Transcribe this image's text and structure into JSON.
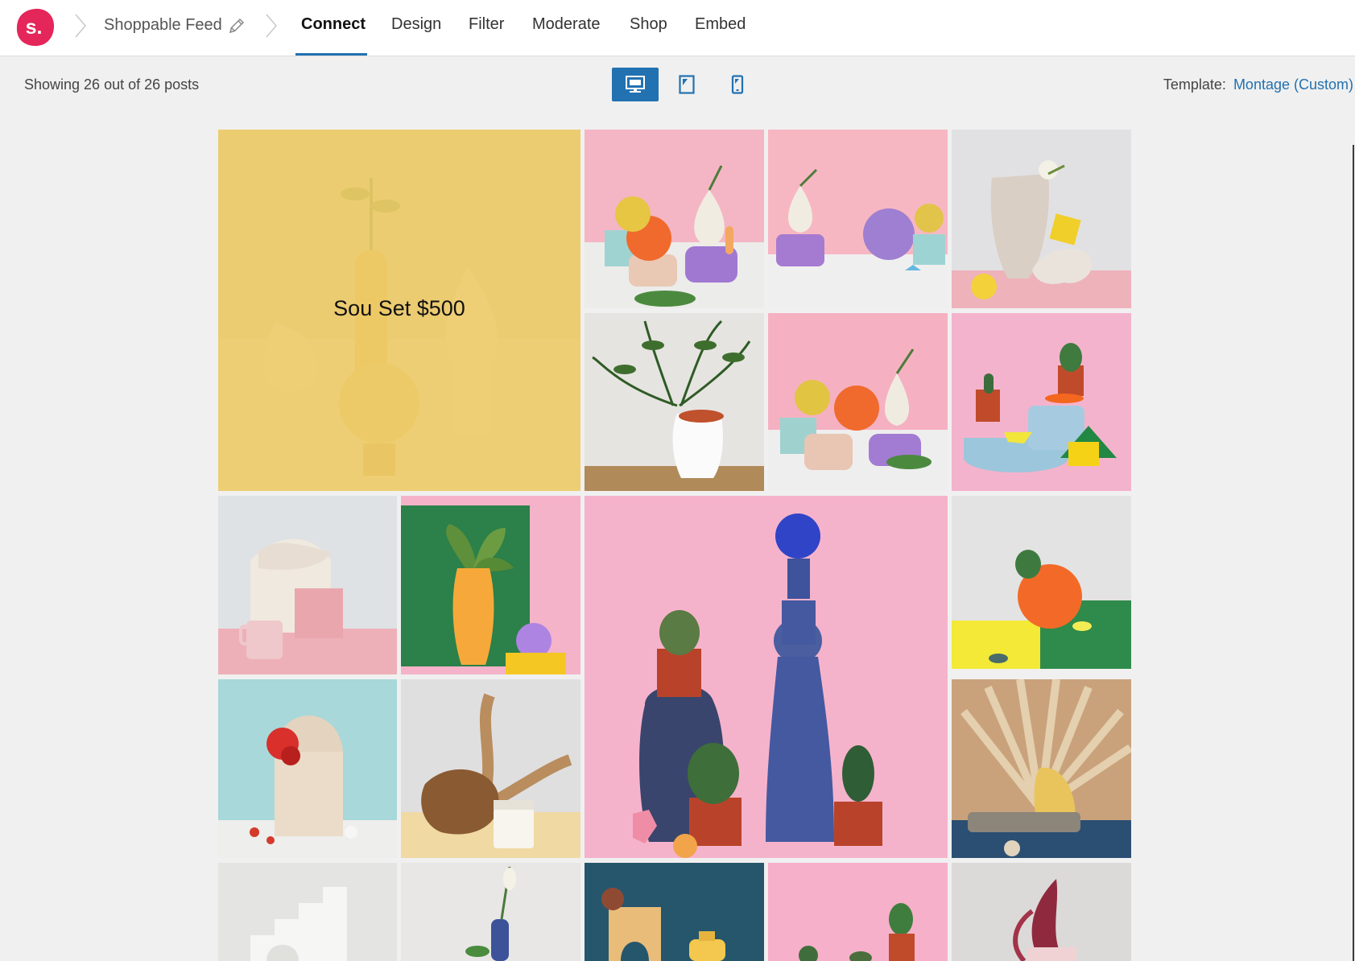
{
  "header": {
    "logo_letter": "s.",
    "feed_name": "Shoppable Feed",
    "tabs": [
      {
        "label": "Connect",
        "active": true
      },
      {
        "label": "Design",
        "active": false
      },
      {
        "label": "Filter",
        "active": false
      },
      {
        "label": "Moderate",
        "active": false
      },
      {
        "label": "Shop",
        "active": false
      },
      {
        "label": "Embed",
        "active": false
      }
    ]
  },
  "toolbar": {
    "post_count": "Showing 26 out of 26 posts",
    "devices": [
      {
        "name": "desktop-icon",
        "active": true
      },
      {
        "name": "tablet-icon",
        "active": false
      },
      {
        "name": "mobile-icon",
        "active": false
      }
    ],
    "template_label": "Template:",
    "template_value": "Montage (Custom)"
  },
  "grid": {
    "featured_caption": "Sou Set $500"
  },
  "colors": {
    "accent": "#2271b1",
    "logo": "#e5265a",
    "featured_overlay": "#eecc68",
    "page_bg": "#f0f0f0"
  }
}
